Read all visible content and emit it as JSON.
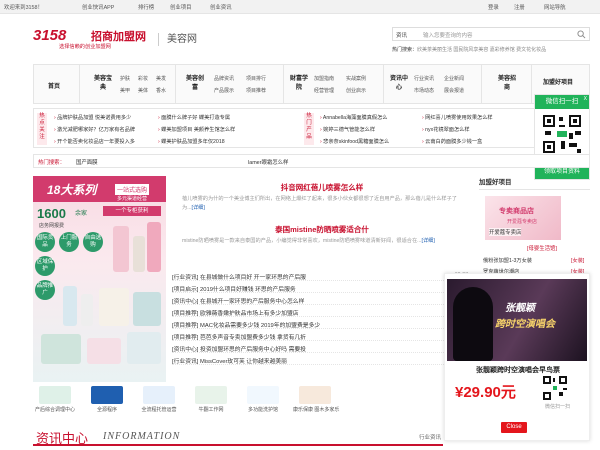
{
  "topbar": {
    "welcome": "欢迎来到3158！",
    "app": "创业快讯APP",
    "rank": "排行榜",
    "project": "创业项目",
    "news": "创业资讯",
    "login": "登录",
    "register": "注册",
    "nav": "网站导航"
  },
  "logo": {
    "brand": "3158",
    "name": "招商加盟网",
    "slogan": "选择信赖的创业加盟网",
    "site": "美容网"
  },
  "search": {
    "scope": "资讯",
    "placeholder": "输入您要查询的内容",
    "hot_label": "热门搜索：",
    "hot_items": "欣美茶美丽生活 国民院风享美容 嘉彩修养馆 费文花化妆品"
  },
  "nav": {
    "home": "首页",
    "groups": [
      {
        "cat": "美容宝典",
        "subs": [
          "护肤",
          "彩妆",
          "美发",
          "美甲",
          "美体",
          "香水"
        ]
      },
      {
        "cat": "美容创富",
        "subs": [
          "品牌资讯",
          "项目排行",
          "产品展示",
          "项目推荐"
        ]
      },
      {
        "cat": "财富学院",
        "subs": [
          "加盟指南",
          "实战案例",
          "经营管理",
          "创业启示"
        ]
      },
      {
        "cat": "资讯中心",
        "subs": [
          "行业资讯",
          "企业新闻",
          "市场动态",
          "展会报道"
        ]
      },
      {
        "cat": "美容招商",
        "subs": []
      },
      {
        "cat": "加盟好项目",
        "subs": []
      }
    ]
  },
  "news_rows": {
    "tag1": "热点关注",
    "tag2": "热门产品",
    "col1": [
      "品牌护肤品加盟 悦美诺费用多少",
      "激光减肥哪家好？亿万家有名品牌",
      "开个能否卖化妆品店一年要投入多"
    ],
    "col2": [
      "面膜什么牌子好 蝶美打造专属",
      "蝶美加盟项目 美颜养生馆怎么样",
      "蝶美护肤品加盟多年仅2018"
    ],
    "col3": [
      "Annabella海藻面膜真假怎么",
      "婉婷三德气管能怎么样",
      "悲亲奈skinfood黑糖面膜怎么"
    ],
    "col4": [
      "网红喜儿喷雾使用效果怎么样",
      "nyx花镜翠面怎么样",
      "云南白药面膜多少钱一盒"
    ]
  },
  "wechat": {
    "title": "微信扫一扫",
    "close": "X",
    "footer": "领取项目资料"
  },
  "location": {
    "here": "热门搜索：",
    "crumb": "国产面膜",
    "headline": "lamer眼霜怎么样"
  },
  "ad1": {
    "series": "18大系列",
    "tag": "一站式选购",
    "tag2": "多元渠道经营",
    "n1600": "1600",
    "n1600b": "余家",
    "n1600c": "店务网报费",
    "red": "一个专柜获利",
    "pills": [
      "国际货品",
      "上门服务",
      "自由选购",
      "区域保护",
      "品牌推广"
    ]
  },
  "feature": {
    "t1": "抖音网红蓓儿喷雾怎么样",
    "d1": "蓓儿喷雾的为什的一个美业博主们所出，在网络上爆红了起来，很多小伙女都很想了近自用产品，那么蓓儿是什么样子了为...",
    "more1": "[详细]",
    "t2": "泰国mistine防晒喷雾适合什",
    "d2": "mistine防晒喷雾是一款来自泰国的产品，小编觉得非常喜欢，mistine防晒喷雾味道清新好闻，很适合在...",
    "more2": "[详细]"
  },
  "list": [
    {
      "t": "[行业资讯] 在县城做什么项目好 开一家环思的产后服",
      "d": "02-27"
    },
    {
      "t": "[项目启示] 2019什么项目好赚钱 环思的产后服务",
      "d": "02-26"
    },
    {
      "t": "[资讯中心] 在县城开一家环思的产后服务中心怎么样",
      "d": "02-25"
    },
    {
      "t": "[项目推荐] 欧雅薇香嫩护肤品市场上有多少加盟店",
      "d": "02-19"
    },
    {
      "t": "[项目推荐] MAC化妆品需要多少钱 2019年的加盟费是多少",
      "d": "12-28"
    },
    {
      "t": "[项目推荐] 芭芭多声音专卖加盟费多少钱 拿货有几折",
      "d": "12-26"
    },
    {
      "t": "[资讯中心] 投资加盟环思的产后服务中心好吗 需要投",
      "d": "09-18"
    },
    {
      "t": "[行业资讯] MissCover玫可芙 让你越来越美丽",
      "d": "07-04"
    }
  ],
  "side": {
    "title": "加盟好项目",
    "img_title": "专卖商品店",
    "img_sub": "开爱蔻专卖店",
    "cap1": "开爱蔻专卖店",
    "cap2": "[母婴生活馆]",
    "li1": "俄粉张加盟1-3万女装",
    "li1b": "[女装]",
    "li2": "罗克萌世尔潮店",
    "li2b": "[女装]"
  },
  "popup": {
    "ph1": "张靓颖",
    "ph2": "跨时空演唱会",
    "title": "张靓颖跨时空演唱会早鸟票",
    "price": "¥29.90元",
    "scan": "微信扫一扫",
    "close": "Close"
  },
  "brands": [
    "产后综合调理中心",
    "全源程序",
    "全流程托管运营",
    "牛翻工作网",
    "多功能洗护馆",
    "康乐保康 图木多家乐"
  ],
  "infohd": {
    "cn": "资讯中心",
    "en": "INFORMATION",
    "more": "行业资讯"
  },
  "colors": {
    "brand": "#c8102e",
    "green": "#20b35a",
    "blue": "#1f5fb0"
  }
}
